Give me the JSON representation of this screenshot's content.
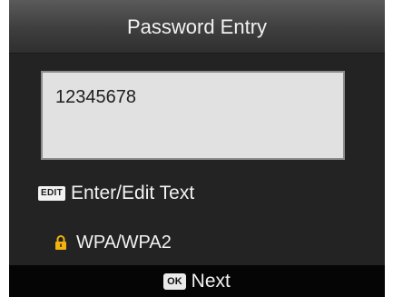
{
  "title": "Password Entry",
  "password": {
    "value": "12345678"
  },
  "edit": {
    "badge": "EDIT",
    "label": "Enter/Edit Text"
  },
  "security": {
    "icon": "lock-icon",
    "label": "WPA/WPA2",
    "icon_color": "#f2b30e"
  },
  "footer": {
    "ok_badge": "OK",
    "next_label": "Next"
  }
}
